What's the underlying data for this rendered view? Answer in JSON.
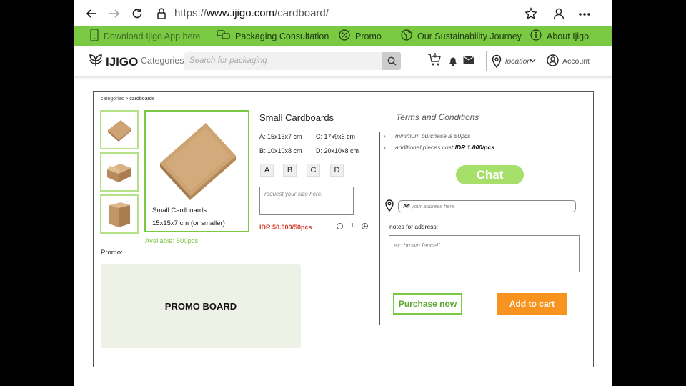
{
  "browser": {
    "url_prefix": "https://",
    "url_domain": "www.ijigo.com",
    "url_path": "/cardboard/",
    "icons": [
      "back-arrow-icon",
      "forward-arrow-icon",
      "refresh-icon",
      "lock-icon",
      "star-icon",
      "profile-icon",
      "more-icon"
    ]
  },
  "topbar": {
    "items": [
      {
        "label": "Download Ijigo App here",
        "icon": "phone-icon"
      },
      {
        "label": "Packaging Consultation",
        "icon": "chat-bubbles-icon"
      },
      {
        "label": "Promo",
        "icon": "percent-icon"
      },
      {
        "label": "Our Sustainability Journey",
        "icon": "globe-icon"
      },
      {
        "label": "About Ijigo",
        "icon": "info-icon"
      }
    ]
  },
  "header": {
    "logo": "IJIGO",
    "categories": "Categories",
    "search_placeholder": "Search for packaging",
    "location": "location",
    "account": "Account"
  },
  "breadcrumb": {
    "root": "categories",
    "separator": ">",
    "current": "cardboards"
  },
  "product": {
    "caption_name": "Small Cardboards",
    "caption_size": "15x15x7 cm (or smaller)",
    "available": "Available: 500pcs",
    "promo_label": "Promo:",
    "promo_board": "PROMO BOARD",
    "title": "Small Cardboards",
    "sizes": {
      "a": "A: 15x15x7 cm",
      "b": "B: 10x10x8 cm",
      "c": "C: 17x9x6 cm",
      "d": "D: 20x10x8 cm"
    },
    "options": [
      "A",
      "B",
      "C",
      "D"
    ],
    "size_request_placeholder": "request your size here!",
    "price": "IDR 50.000/50pcs",
    "quantity": "1",
    "stepper_plus": "+"
  },
  "terms": {
    "title": "Terms and Conditions",
    "line1": "minimum purchase is 50pcs",
    "line2_prefix": "additional pieces cost ",
    "line2_bold": "IDR 1.000/pcs",
    "chat": "Chat",
    "address_placeholder": "Fill your address here",
    "notes_label": "notes for address:",
    "notes_placeholder": "ex: brown fence!!",
    "purchase": "Purchase now",
    "add_to_cart": "Add to cart"
  },
  "colors": {
    "brand_green": "#7ac943",
    "chat_green": "#a6e06a",
    "cart_orange": "#f7931e",
    "price_red": "#d43a2a"
  }
}
